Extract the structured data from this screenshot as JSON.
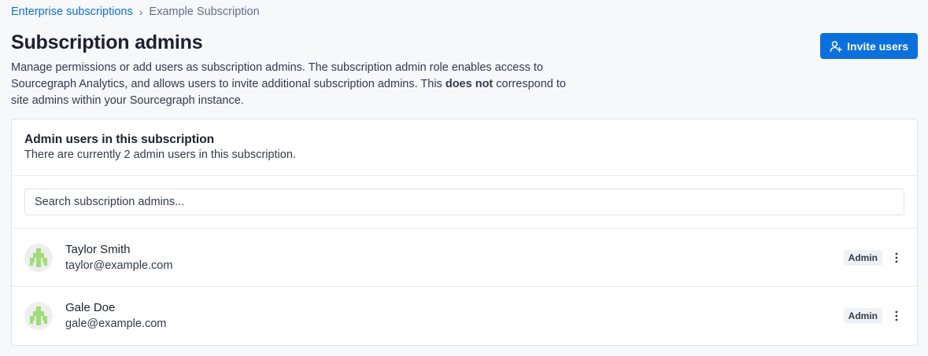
{
  "breadcrumb": {
    "parent": "Enterprise subscriptions",
    "separator": "›",
    "current": "Example Subscription"
  },
  "header": {
    "title": "Subscription admins",
    "description_part1": "Manage permissions or add users as subscription admins. The subscription admin role enables access to Sourcegraph Analytics, and allows users to invite additional subscription admins. This ",
    "description_bold": "does not",
    "description_part2": " correspond to site admins within your Sourcegraph instance.",
    "invite_button_label": "Invite users",
    "invite_button_icon": "user-plus-icon"
  },
  "card": {
    "title": "Admin users in this subscription",
    "subtitle": "There are currently 2 admin users in this subscription.",
    "search": {
      "placeholder": "Search subscription admins...",
      "value": ""
    }
  },
  "users": [
    {
      "name": "Taylor Smith",
      "email": "taylor@example.com",
      "role": "Admin"
    },
    {
      "name": "Gale Doe",
      "email": "gale@example.com",
      "role": "Admin"
    }
  ],
  "colors": {
    "accent": "#0b70db",
    "avatar_pattern": "#9fdc7a",
    "avatar_bg": "#eeeeee"
  }
}
